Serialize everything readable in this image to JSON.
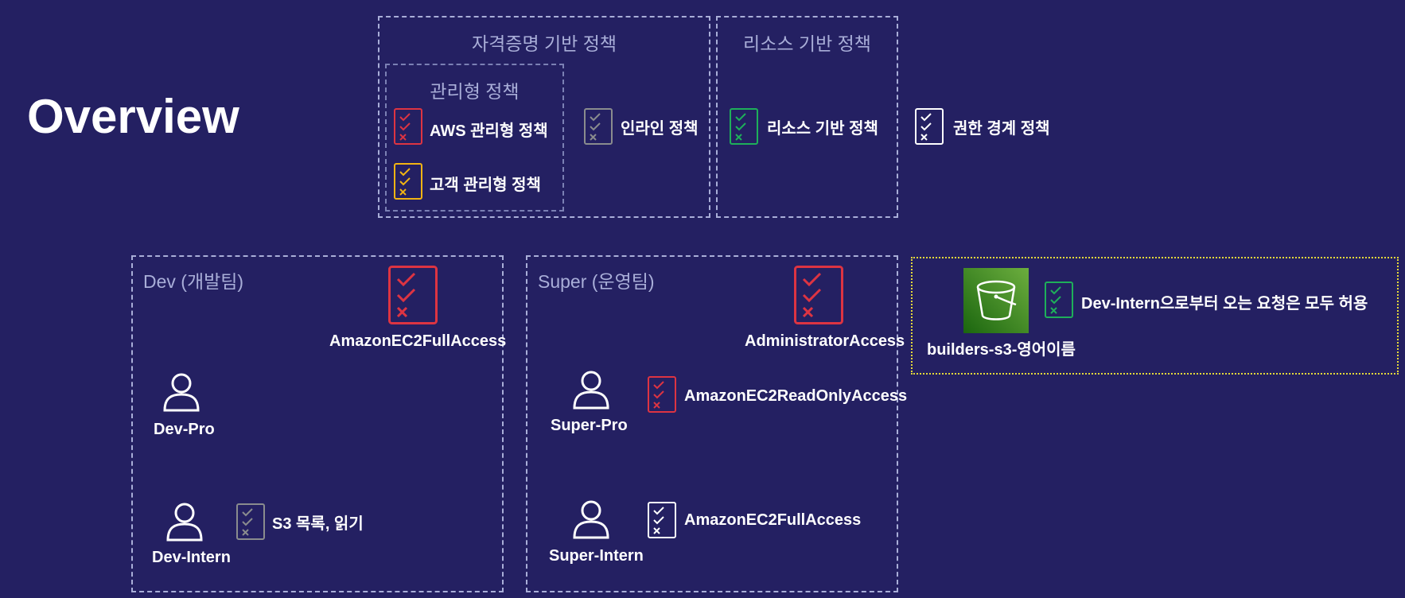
{
  "title": "Overview",
  "legend": {
    "identity_based": "자격증명 기반 정책",
    "resource_based_header": "리소스 기반 정책",
    "managed": "관리형 정책",
    "aws_managed": "AWS 관리형 정책",
    "customer_managed": "고객 관리형 정책",
    "inline": "인라인 정책",
    "resource_based": "리소스 기반 정책",
    "permission_boundary": "권한 경계 정책"
  },
  "dev_group": {
    "title": "Dev (개발팀)",
    "policy": "AmazonEC2FullAccess",
    "user_pro": "Dev-Pro",
    "user_intern": "Dev-Intern",
    "intern_inline": "S3 목록, 읽기"
  },
  "super_group": {
    "title": "Super (운영팀)",
    "policy": "AdministratorAccess",
    "user_pro": "Super-Pro",
    "user_pro_policy": "AmazonEC2ReadOnlyAccess",
    "user_intern": "Super-Intern",
    "user_intern_policy": "AmazonEC2FullAccess"
  },
  "bucket": {
    "name": "builders-s3-영어이름",
    "policy": "Dev-Intern으로부터 오는 요청은 모두 허용"
  },
  "colors": {
    "background": "#242062",
    "aws_managed": "#dd3442",
    "customer_managed": "#f2b413",
    "inline": "#8a8c8e",
    "resource_based": "#1eaf5a",
    "boundary": "#ffffff",
    "bucket": "#3f8624"
  },
  "icons": {
    "policy": "policy-document-icon",
    "user": "user-icon",
    "bucket": "s3-bucket-icon"
  }
}
